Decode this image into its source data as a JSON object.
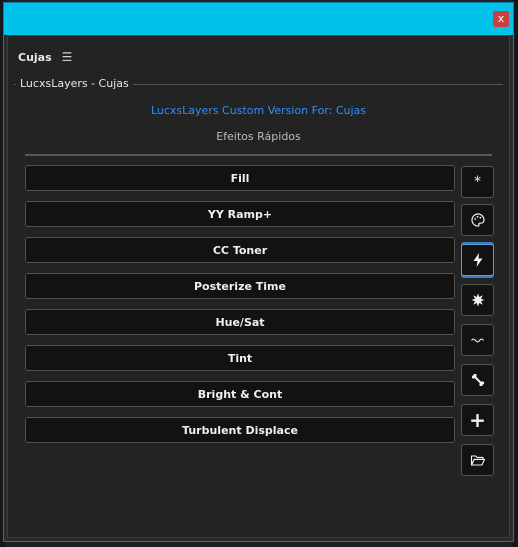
{
  "window": {
    "close_label": "x"
  },
  "panel": {
    "title": "Cujas",
    "menu_glyph": "☰"
  },
  "group": {
    "label": "LucxsLayers - Cujas"
  },
  "custom_version": "LucxsLayers Custom Version For: Cujas",
  "subtitle": "Efeitos Rápidos",
  "effects": [
    "Fill",
    "YY Ramp+",
    "CC Toner",
    "Posterize Time",
    "Hue/Sat",
    "Tint",
    "Bright & Cont",
    "Turbulent Displace"
  ],
  "sidebar": {
    "star_glyph": "*",
    "plus_glyph": "+",
    "icons": [
      "asterisk-icon",
      "palette-icon",
      "lightning-icon",
      "burst-icon",
      "wave-icon",
      "bone-icon",
      "plus-icon",
      "folder-open-icon"
    ],
    "active": "lightning-icon"
  },
  "colors": {
    "titlebar": "#00c2ea",
    "accent_text": "#2f8fff",
    "close": "#c9403f",
    "button_bg": "#121212"
  }
}
